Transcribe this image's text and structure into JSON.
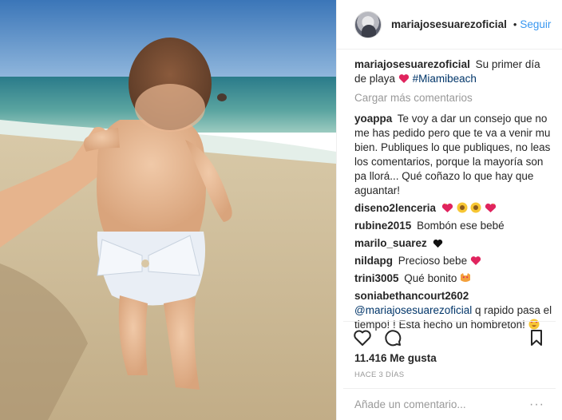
{
  "post": {
    "username": "mariajosesuarezoficial",
    "separator": "•",
    "follow_label": "Seguir",
    "caption_user": "mariajosesuarezoficial",
    "caption_text": "Su primer día de playa",
    "caption_hashtag": "#Miamibeach",
    "load_more_label": "Cargar más comentarios",
    "likes": "11.416 Me gusta",
    "timestamp": "HACE 3 DÍAS",
    "add_comment_placeholder": "Añade un comentario...",
    "options_label": "···"
  },
  "comments": [
    {
      "user": "yoappa",
      "text": "Te voy a dar un consejo que no me has pedido pero que te va a venir mu bien. Publiques lo que publiques, no leas los comentarios, porque la mayoría son pa llorá... Qué coñazo lo que hay que aguantar!"
    },
    {
      "user": "diseno2lenceria",
      "text": ""
    },
    {
      "user": "rubine2015",
      "text": "Bombón ese bebé"
    },
    {
      "user": "marilo_suarez",
      "text": ""
    },
    {
      "user": "nildapg",
      "text": "Precioso bebe"
    },
    {
      "user": "trini3005",
      "text": "Qué bonito"
    },
    {
      "user": "soniabethancourt2602",
      "mention": "@mariajosesuarezoficial",
      "text": "q rapido pasa el tiempo! ! Esta hecho un hombreton!"
    }
  ],
  "icons": {
    "like": "heart-outline-icon",
    "comment": "speech-bubble-icon",
    "save": "bookmark-icon",
    "verified": "verified-badge-icon"
  },
  "colors": {
    "link": "#3897f0",
    "hashtag": "#003569",
    "heart_red": "#e0245e",
    "muted": "#999999"
  }
}
